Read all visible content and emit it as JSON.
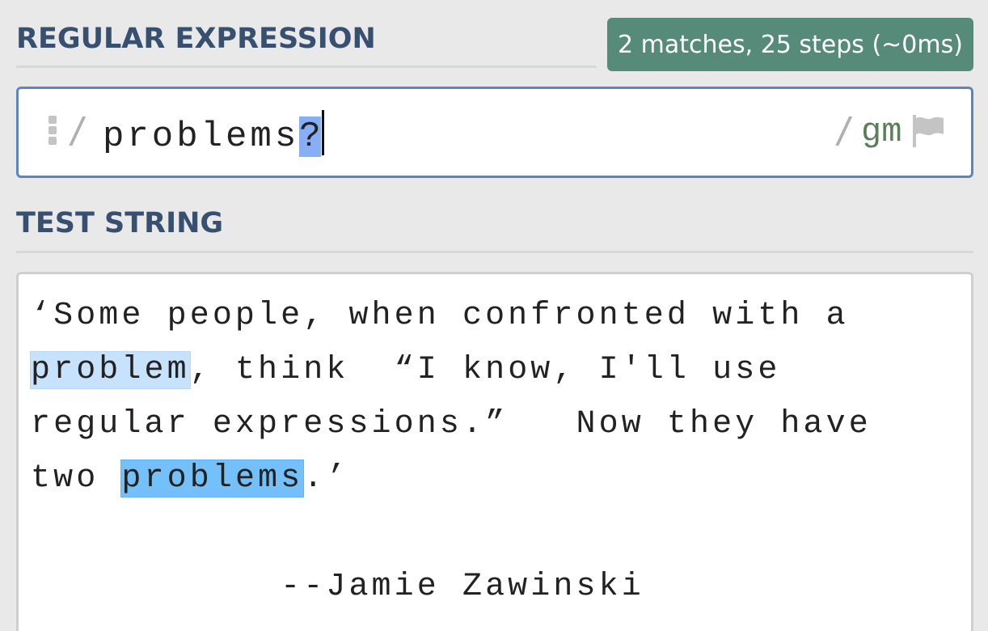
{
  "regex_section": {
    "title": "REGULAR EXPRESSION",
    "match_info": "2 matches, 25 steps (~0ms)",
    "open_delimiter": "/",
    "pattern_main": "problems",
    "pattern_quantifier": "?",
    "close_delimiter": "/",
    "flags": "gm"
  },
  "test_section": {
    "title": "TEST STRING",
    "parts": [
      "‘Some people, when confronted with a\n",
      "problem",
      ", think  “I know, I'll use\nregular expressions.”   Now they have\ntwo ",
      "problems",
      ".’\n\n           --Jamie Zawinski"
    ]
  },
  "colors": {
    "title": "#37506f",
    "badge_bg": "#578b79",
    "regex_border": "#5d86c0",
    "quantifier_highlight": "#88aef6",
    "match_light": "#c7e2fd",
    "match_strong": "#73c0fb",
    "flags": "#5b7f5b"
  },
  "icons": [
    "drag-handle-icon",
    "flag-icon"
  ]
}
